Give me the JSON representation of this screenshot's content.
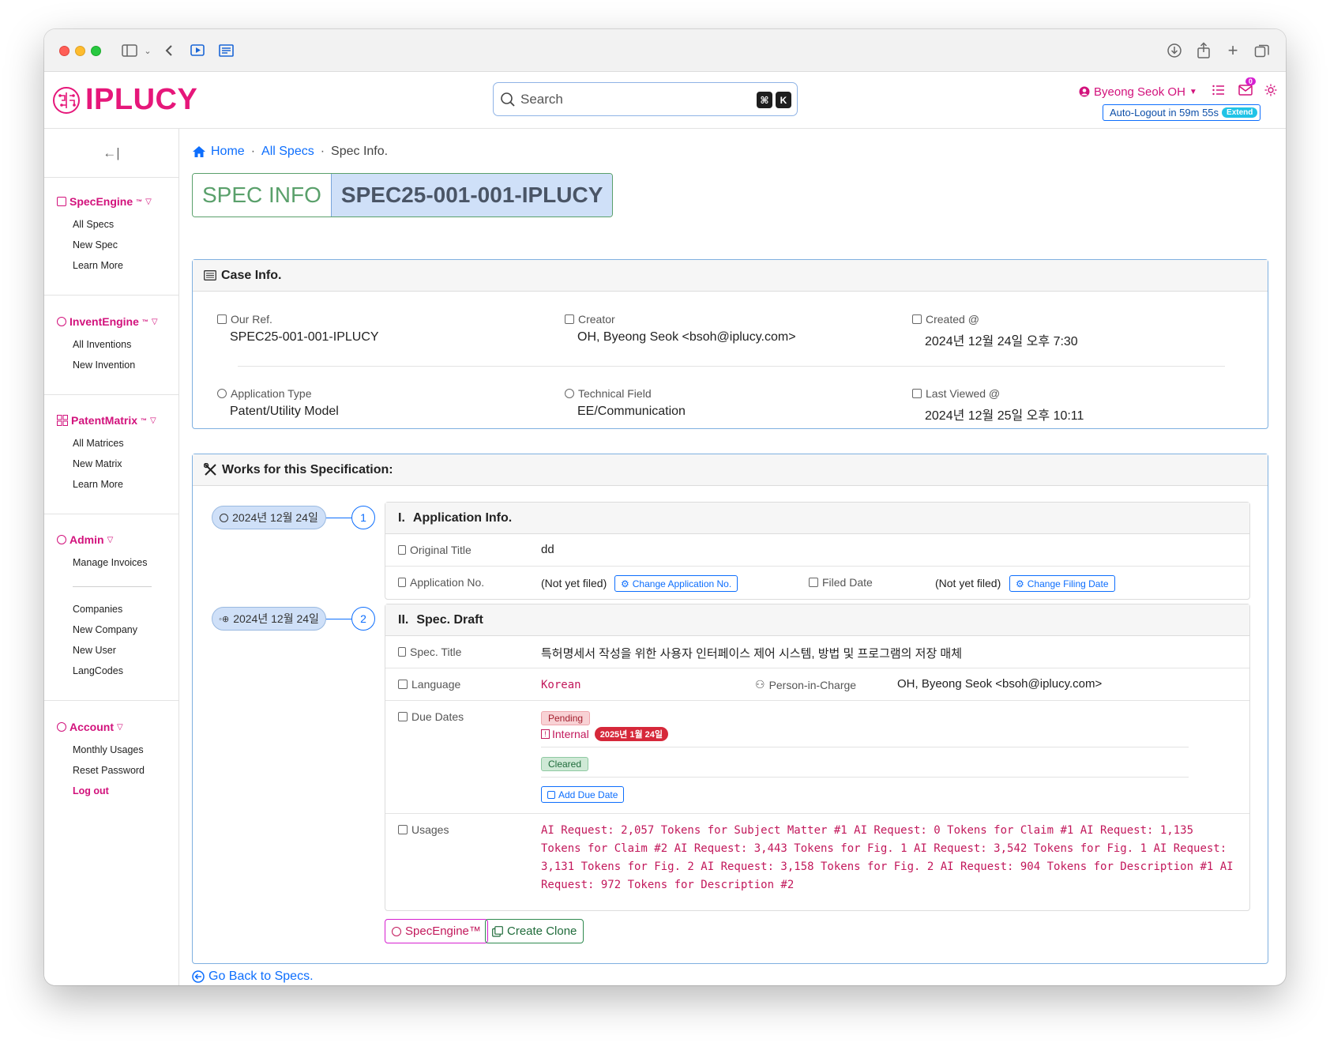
{
  "browser": {
    "icons": [
      "sidebar-icon",
      "chevron-down-icon",
      "back-icon",
      "picture-in-picture-icon",
      "reader-icon",
      "download-icon",
      "share-icon",
      "new-tab-icon",
      "tabs-overview-icon"
    ]
  },
  "header": {
    "logo_text": "IPLUCY",
    "search_placeholder": "Search",
    "kbd1": "⌘",
    "kbd2": "K",
    "user_name": "Byeong Seok OH",
    "mail_count": "0",
    "autologout_text": "Auto-Logout in 59m 55s",
    "extend_label": "Extend"
  },
  "sidebar": {
    "collapse_label": "←|",
    "specengine": {
      "title": "SpecEngine",
      "tm": "™",
      "items": [
        "All Specs",
        "New Spec",
        "Learn More"
      ]
    },
    "inventengine": {
      "title": "InventEngine",
      "tm": "™",
      "items": [
        "All Inventions",
        "New Invention"
      ]
    },
    "patentmatrix": {
      "title": "PatentMatrix",
      "tm": "™",
      "items": [
        "All Matrices",
        "New Matrix",
        "Learn More"
      ]
    },
    "admin": {
      "title": "Admin",
      "items": [
        "Manage Invoices",
        "Companies",
        "New Company",
        "New User",
        "LangCodes"
      ]
    },
    "account": {
      "title": "Account",
      "items": [
        "Monthly Usages",
        "Reset Password",
        "Log out"
      ]
    }
  },
  "breadcrumb": {
    "home": "Home",
    "all_specs": "All Specs",
    "current": "Spec Info."
  },
  "title": {
    "label": "SPEC INFO",
    "spec_id": "SPEC25-001-001-IPLUCY"
  },
  "case_info": {
    "header": "Case Info.",
    "our_ref_label": "Our Ref.",
    "our_ref": "SPEC25-001-001-IPLUCY",
    "creator_label": "Creator",
    "creator": "OH, Byeong Seok <bsoh@iplucy.com>",
    "created_label": "Created @",
    "created": "2024년 12월 24일 오후 7:30",
    "app_type_label": "Application Type",
    "app_type": "Patent/Utility Model",
    "tech_field_label": "Technical Field",
    "tech_field": "EE/Communication",
    "last_viewed_label": "Last Viewed @",
    "last_viewed": "2024년 12월 25일 오후 10:11"
  },
  "works": {
    "header": "Works for this Specification:",
    "timeline": [
      {
        "date": "2024년 12월 24일",
        "num": "1"
      },
      {
        "date": "2024년 12월 24일",
        "num": "2"
      }
    ],
    "app_info": {
      "header_num": "I.",
      "header": "Application Info.",
      "orig_title_label": "Original Title",
      "orig_title": "dd",
      "app_no_label": "Application No.",
      "app_no": "(Not yet filed)",
      "change_app_no": "Change Application No.",
      "filed_date_label": "Filed Date",
      "filed_date": "(Not yet filed)",
      "change_filing_date": "Change Filing Date"
    },
    "spec_draft": {
      "header_num": "II.",
      "header": "Spec. Draft",
      "spec_title_label": "Spec. Title",
      "spec_title": "특허명세서 작성을 위한 사용자 인터페이스 제어 시스템, 방법 및 프로그램의 저장 매체",
      "language_label": "Language",
      "language": "Korean",
      "pic_label": "Person-in-Charge",
      "pic": "OH, Byeong Seok <bsoh@iplucy.com>",
      "due_dates_label": "Due Dates",
      "pending": "Pending",
      "internal": "Internal",
      "internal_date": "2025년 1월 24일",
      "cleared": "Cleared",
      "add_due_date": "Add Due Date",
      "usages_label": "Usages",
      "usages": "AI Request: 2,057 Tokens for Subject Matter #1 AI Request: 0 Tokens for Claim #1 AI Request: 1,135 Tokens for Claim #2 AI Request: 3,443 Tokens for Fig. 1 AI Request: 3,542 Tokens for Fig. 1 AI Request: 3,131 Tokens for Fig. 2 AI Request: 3,158 Tokens for Fig. 2 AI Request: 904 Tokens for Description #1 AI Request: 972 Tokens for Description #2"
    },
    "specengine_btn": "SpecEngine™",
    "clone_btn": "Create Clone"
  },
  "go_back": "Go Back to Specs.",
  "colors": {
    "brand": "#e6177a",
    "link": "#0d6efd",
    "accent_border": "#7fb0e0"
  }
}
